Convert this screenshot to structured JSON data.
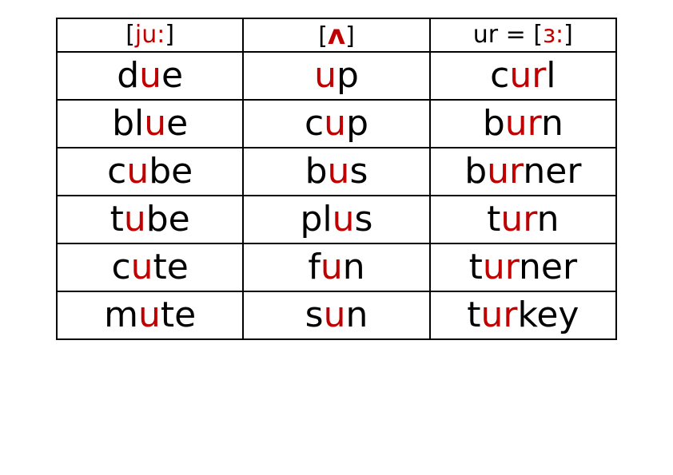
{
  "colors": {
    "red": "#c00000",
    "black": "#000000"
  },
  "headers": [
    {
      "segments": [
        {
          "t": "[",
          "c": "blk"
        },
        {
          "t": "ju:",
          "c": "red"
        },
        {
          "t": "]",
          "c": "blk"
        }
      ]
    },
    {
      "segments": [
        {
          "t": "[",
          "c": "blk"
        },
        {
          "t": "ʌ",
          "c": "red",
          "caret": true
        },
        {
          "t": "]",
          "c": "blk"
        }
      ]
    },
    {
      "segments": [
        {
          "t": "ur = [",
          "c": "blk"
        },
        {
          "t": "ɜ:",
          "c": "red"
        },
        {
          "t": "]",
          "c": "blk"
        }
      ]
    }
  ],
  "rows": [
    [
      {
        "segments": [
          {
            "t": "d",
            "c": "blk"
          },
          {
            "t": "u",
            "c": "red"
          },
          {
            "t": "e",
            "c": "blk"
          }
        ]
      },
      {
        "segments": [
          {
            "t": "u",
            "c": "red"
          },
          {
            "t": "p",
            "c": "blk"
          }
        ]
      },
      {
        "segments": [
          {
            "t": "c",
            "c": "blk"
          },
          {
            "t": "ur",
            "c": "red"
          },
          {
            "t": "l",
            "c": "blk"
          }
        ]
      }
    ],
    [
      {
        "segments": [
          {
            "t": "bl",
            "c": "blk"
          },
          {
            "t": "u",
            "c": "red"
          },
          {
            "t": "e",
            "c": "blk"
          }
        ]
      },
      {
        "segments": [
          {
            "t": "c",
            "c": "blk"
          },
          {
            "t": "u",
            "c": "red"
          },
          {
            "t": "p",
            "c": "blk"
          }
        ]
      },
      {
        "segments": [
          {
            "t": "b",
            "c": "blk"
          },
          {
            "t": "ur",
            "c": "red"
          },
          {
            "t": "n",
            "c": "blk"
          }
        ]
      }
    ],
    [
      {
        "segments": [
          {
            "t": "c",
            "c": "blk"
          },
          {
            "t": "u",
            "c": "red"
          },
          {
            "t": "be",
            "c": "blk"
          }
        ]
      },
      {
        "segments": [
          {
            "t": "b",
            "c": "blk"
          },
          {
            "t": "u",
            "c": "red"
          },
          {
            "t": "s",
            "c": "blk"
          }
        ]
      },
      {
        "segments": [
          {
            "t": "b",
            "c": "blk"
          },
          {
            "t": "ur",
            "c": "red"
          },
          {
            "t": "ner",
            "c": "blk"
          }
        ]
      }
    ],
    [
      {
        "segments": [
          {
            "t": "t",
            "c": "blk"
          },
          {
            "t": "u",
            "c": "red"
          },
          {
            "t": "be",
            "c": "blk"
          }
        ]
      },
      {
        "segments": [
          {
            "t": "pl",
            "c": "blk"
          },
          {
            "t": "u",
            "c": "red"
          },
          {
            "t": "s",
            "c": "blk"
          }
        ]
      },
      {
        "segments": [
          {
            "t": "t",
            "c": "blk"
          },
          {
            "t": "ur",
            "c": "red"
          },
          {
            "t": "n",
            "c": "blk"
          }
        ]
      }
    ],
    [
      {
        "segments": [
          {
            "t": "c",
            "c": "blk"
          },
          {
            "t": "u",
            "c": "red"
          },
          {
            "t": "te",
            "c": "blk"
          }
        ]
      },
      {
        "segments": [
          {
            "t": "f",
            "c": "blk"
          },
          {
            "t": "u",
            "c": "red"
          },
          {
            "t": "n",
            "c": "blk"
          }
        ]
      },
      {
        "segments": [
          {
            "t": "t",
            "c": "blk"
          },
          {
            "t": "ur",
            "c": "red"
          },
          {
            "t": "ner",
            "c": "blk"
          }
        ]
      }
    ],
    [
      {
        "segments": [
          {
            "t": "m",
            "c": "blk"
          },
          {
            "t": "u",
            "c": "red"
          },
          {
            "t": "te",
            "c": "blk"
          }
        ]
      },
      {
        "segments": [
          {
            "t": "s",
            "c": "blk"
          },
          {
            "t": "u",
            "c": "red"
          },
          {
            "t": "n",
            "c": "blk"
          }
        ]
      },
      {
        "segments": [
          {
            "t": "t",
            "c": "blk"
          },
          {
            "t": "ur",
            "c": "red"
          },
          {
            "t": "key",
            "c": "blk"
          }
        ]
      }
    ]
  ],
  "chart_data": {
    "type": "table",
    "columns": [
      "[ju:]",
      "[ʌ]",
      "ur = [ɜ:]"
    ],
    "rows": [
      [
        "due",
        "up",
        "curl"
      ],
      [
        "blue",
        "cup",
        "burn"
      ],
      [
        "cube",
        "bus",
        "burner"
      ],
      [
        "tube",
        "plus",
        "turn"
      ],
      [
        "cute",
        "fun",
        "turner"
      ],
      [
        "mute",
        "sun",
        "turkey"
      ]
    ]
  }
}
